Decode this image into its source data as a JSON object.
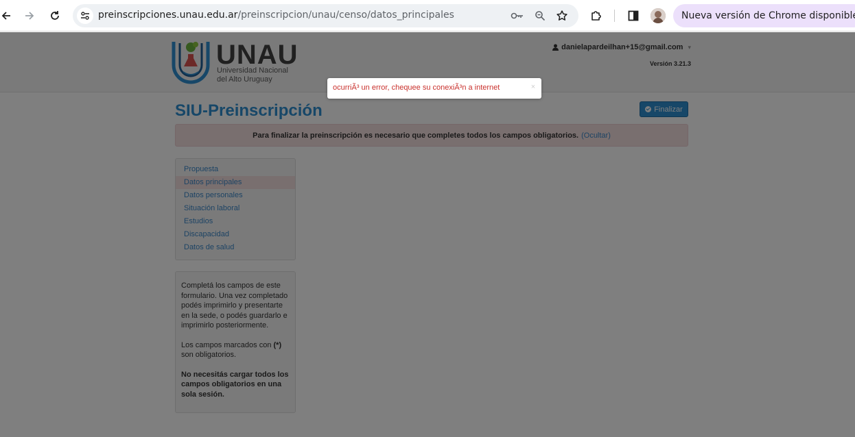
{
  "browser": {
    "url_host": "preinscripciones.unau.edu.ar",
    "url_path": "/preinscripcion/unau/censo/datos_principales",
    "update_label": "Nueva versión de Chrome disponible",
    "icons": [
      "back-icon",
      "forward-icon",
      "reload-icon",
      "site-settings-icon",
      "password-key-icon",
      "zoom-icon",
      "bookmark-star-icon",
      "extensions-icon",
      "side-panel-icon",
      "profile-avatar"
    ]
  },
  "header": {
    "logo_word": "UNAU",
    "logo_sub1": "Universidad Nacional",
    "logo_sub2": "del Alto Uruguay",
    "user_email": "danielapardeilhan+15@gmail.com",
    "version": "Versión 3.21.3"
  },
  "main": {
    "title": "SIU-Preinscripción",
    "finalize_label": "Finalizar",
    "alert_text": "Para finalizar la preinscripción es necesario que completes todos los campos obligatorios.",
    "alert_link": "(Ocultar)"
  },
  "nav": {
    "items": [
      {
        "label": "Propuesta"
      },
      {
        "label": "Datos principales"
      },
      {
        "label": "Datos personales"
      },
      {
        "label": "Situación laboral"
      },
      {
        "label": "Estudios"
      },
      {
        "label": "Discapacidad"
      },
      {
        "label": "Datos de salud"
      }
    ],
    "active_index": 1
  },
  "help": {
    "p1": "Completá los campos de este formulario. Una vez completado podés imprimirlo y presentarte en la sede, o podés guardarlo e imprimirlo posteriormente.",
    "p2_a": "Los campos marcados con ",
    "p2_b": "(*)",
    "p2_c": " son obligatorios.",
    "p3": "No necesitás cargar todos los campos obligatorios en una sola sesión."
  },
  "toast": {
    "message": "ocurriÃ³ un error, chequee su conexiÃ³n a internet",
    "close": "×"
  },
  "colors": {
    "accent": "#2f8fd0",
    "alert_bg": "#f2dede",
    "error_text": "#c9302c",
    "chrome_update_bg": "#ece0fb"
  }
}
